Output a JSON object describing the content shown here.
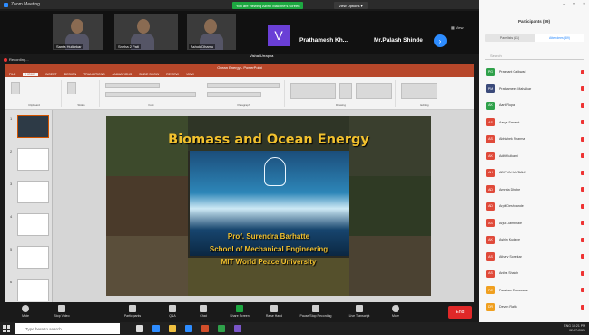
{
  "zoom": {
    "window_title": "Zoom Meeting",
    "share_banner": "You are viewing Albrel Machhe's screen",
    "view_options": "View Options ▾",
    "gallery_label": "▦ View",
    "participants": [
      {
        "name": "Santa Hullorkar"
      },
      {
        "name": "Sneha 2 Pati"
      },
      {
        "name": "Ashok Dhamu"
      }
    ],
    "tile_v": {
      "letter": "V",
      "name": "Vishal Urrapha"
    },
    "speaker_names": [
      "Prathamesh Kh...",
      "Mr.Palash Shinde"
    ],
    "next_icon": "›",
    "recording_label": "Recording...",
    "toolbar": [
      {
        "label": "Mute",
        "icon": "mic-icon"
      },
      {
        "label": "Stop Video",
        "icon": "video-icon"
      },
      {
        "label": "Participants",
        "icon": "participants-icon"
      },
      {
        "label": "Q&A",
        "icon": "qa-icon"
      },
      {
        "label": "Chat",
        "icon": "chat-icon"
      },
      {
        "label": "Share Screen",
        "icon": "share-icon"
      },
      {
        "label": "Raise Hand",
        "icon": "raise-hand-icon"
      },
      {
        "label": "Pause/Stop Recording",
        "icon": "record-icon"
      },
      {
        "label": "Live Transcript",
        "icon": "transcript-icon"
      },
      {
        "label": "More",
        "icon": "more-icon"
      }
    ],
    "end_label": "End"
  },
  "ppt": {
    "title": "Ocean Energy - PowerPoint",
    "tabs": [
      "FILE",
      "HOME",
      "INSERT",
      "DESIGN",
      "TRANSITIONS",
      "ANIMATIONS",
      "SLIDE SHOW",
      "REVIEW",
      "VIEW"
    ],
    "ribbon_groups": [
      "Clipboard",
      "Slides",
      "Font",
      "Paragraph",
      "Drawing",
      "Editing"
    ],
    "thumb_numbers": [
      "1",
      "2",
      "3",
      "4",
      "5",
      "6"
    ]
  },
  "slide": {
    "title": "Biomass and Ocean Energy",
    "presenter": "Prof. Surendra Barhatte",
    "school": "School of Mechanical Engineering",
    "university": "MIT World Peace University"
  },
  "panel": {
    "title": "Participants (89)",
    "tab_panelists": "Panelists (11)",
    "tab_attendees": "Attendees (89)",
    "search_placeholder": "Search",
    "attendees": [
      {
        "initials": "PG",
        "name": "Prashant Gaikwad",
        "color": "#2fa14a"
      },
      {
        "initials": "PM",
        "name": "Prathamesh Mahalkar",
        "color": "#3b4a7a"
      },
      {
        "initials": "AK",
        "name": "Aarti Rupal",
        "color": "#2fa14a"
      },
      {
        "initials": "AS",
        "name": "Aarya Sawant",
        "color": "#e04a3a"
      },
      {
        "initials": "AS",
        "name": "Abhishek Sharma",
        "color": "#e04a3a"
      },
      {
        "initials": "AK",
        "name": "Aditi Kulkarni",
        "color": "#e04a3a"
      },
      {
        "initials": "AH",
        "name": "ADITYA HAYBALE",
        "color": "#e04a3a"
      },
      {
        "initials": "AD",
        "name": "Amruta Dhobe",
        "color": "#e04a3a"
      },
      {
        "initials": "AD",
        "name": "Arpit Deshpande",
        "color": "#e04a3a"
      },
      {
        "initials": "AS",
        "name": "Arjun Jambhale",
        "color": "#e04a3a"
      },
      {
        "initials": "AK",
        "name": "Ashlin Kudave",
        "color": "#e04a3a"
      },
      {
        "initials": "AS",
        "name": "Atharv Sonekar",
        "color": "#e04a3a"
      },
      {
        "initials": "AS",
        "name": "Aniha Shaikh",
        "color": "#e04a3a"
      },
      {
        "initials": "DS",
        "name": "Darshan Sonawane",
        "color": "#f0a020"
      },
      {
        "initials": "DR",
        "name": "Deven Rahk",
        "color": "#f0a020"
      }
    ]
  },
  "taskbar": {
    "search_placeholder": "Type here to search",
    "time": "10:21 PM",
    "date": "02-07-2021",
    "lang": "ENG"
  }
}
